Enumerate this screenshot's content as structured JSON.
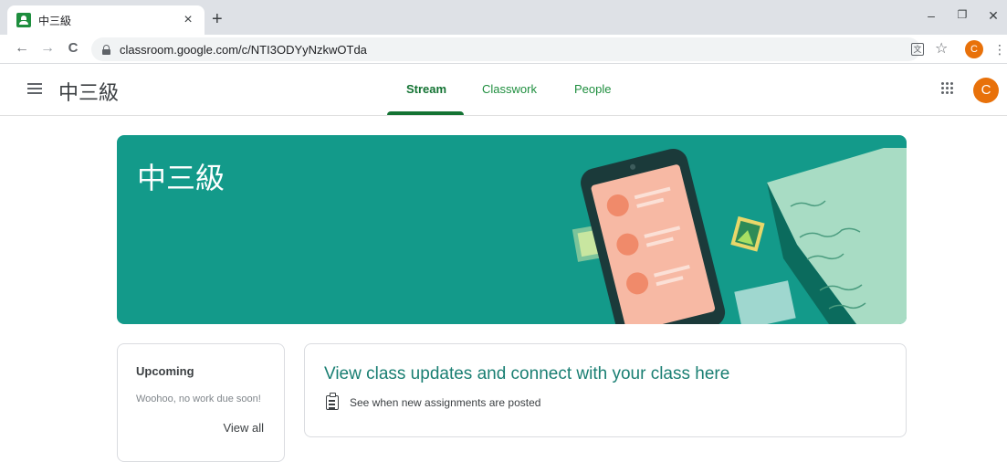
{
  "browser": {
    "tab_title": "中三級",
    "tab_close": "×",
    "new_tab": "+",
    "url": "classroom.google.com/c/NTI3ODYyNzkwOTda",
    "profile_initial": "C",
    "window_controls": {
      "minimize": "–",
      "restore": "❐",
      "close": "✕"
    },
    "nav": {
      "back": "←",
      "forward": "→",
      "reload": "C"
    }
  },
  "header": {
    "class_name": "中三級",
    "tabs": [
      {
        "label": "Stream",
        "active": true
      },
      {
        "label": "Classwork",
        "active": false
      },
      {
        "label": "People",
        "active": false
      }
    ],
    "avatar_initial": "C"
  },
  "banner": {
    "title": "中三級",
    "color": "#139a8a"
  },
  "upcoming": {
    "title": "Upcoming",
    "empty_text": "Woohoo, no work due soon!",
    "view_all": "View all"
  },
  "stream": {
    "title": "View class updates and connect with your class here",
    "items": [
      {
        "icon": "clipboard-icon",
        "text": "See when new assignments are posted"
      }
    ]
  },
  "colors": {
    "accent": "#137333",
    "avatar": "#e8710a"
  }
}
